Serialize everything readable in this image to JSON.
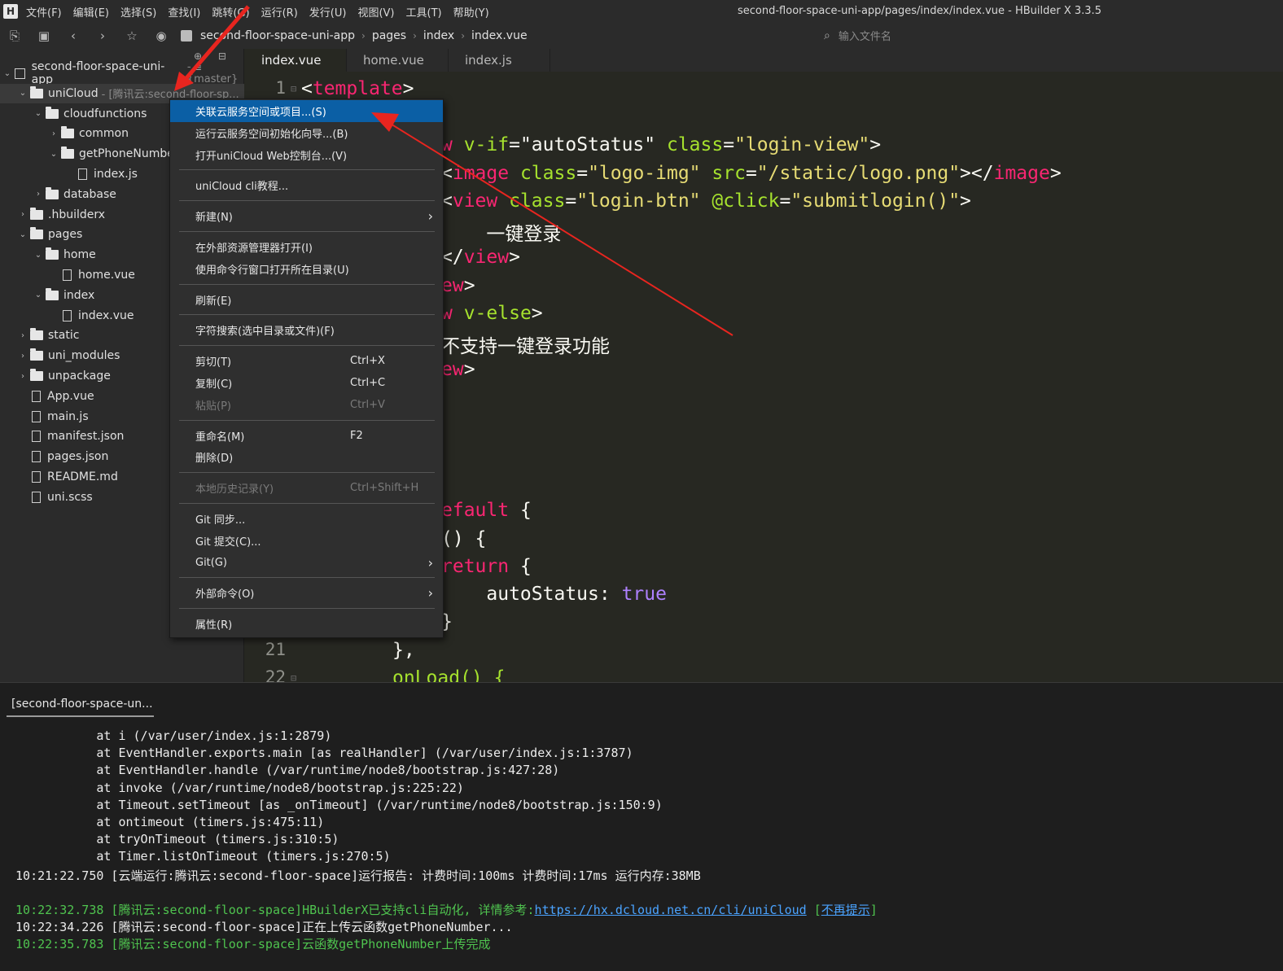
{
  "window": {
    "app_logo": "H",
    "title": "second-floor-space-uni-app/pages/index/index.vue - HBuilder X 3.3.5",
    "menu": [
      "文件(F)",
      "编辑(E)",
      "选择(S)",
      "查找(I)",
      "跳转(G)",
      "运行(R)",
      "发行(U)",
      "视图(V)",
      "工具(T)",
      "帮助(Y)"
    ]
  },
  "toolbar": {
    "icons": [
      "new-file-icon",
      "save-icon",
      "back-icon",
      "forward-icon",
      "star-icon",
      "run-icon"
    ],
    "breadcrumb": [
      "second-floor-space-uni-app",
      "pages",
      "index",
      "index.vue"
    ],
    "search_placeholder": "输入文件名"
  },
  "sidebar": {
    "tree": [
      {
        "label": "second-floor-space-uni-app",
        "suffix": "- {master}",
        "depth": 0,
        "type": "project",
        "expanded": true
      },
      {
        "label": "uniCloud",
        "suffix": "- [腾讯云:second-floor-sp...",
        "depth": 1,
        "type": "folder",
        "expanded": true,
        "selected": true
      },
      {
        "label": "cloudfunctions",
        "depth": 2,
        "type": "folder",
        "expanded": true
      },
      {
        "label": "common",
        "depth": 3,
        "type": "folder",
        "expanded": false
      },
      {
        "label": "getPhoneNumber",
        "depth": 3,
        "type": "folder",
        "expanded": true
      },
      {
        "label": "index.js",
        "depth": 4,
        "type": "file"
      },
      {
        "label": "database",
        "depth": 2,
        "type": "folder",
        "expanded": false
      },
      {
        "label": ".hbuilderx",
        "depth": 1,
        "type": "folder",
        "expanded": false
      },
      {
        "label": "pages",
        "depth": 1,
        "type": "folder",
        "expanded": true
      },
      {
        "label": "home",
        "depth": 2,
        "type": "folder",
        "expanded": true
      },
      {
        "label": "home.vue",
        "depth": 3,
        "type": "file"
      },
      {
        "label": "index",
        "depth": 2,
        "type": "folder",
        "expanded": true
      },
      {
        "label": "index.vue",
        "depth": 3,
        "type": "file"
      },
      {
        "label": "static",
        "depth": 1,
        "type": "folder",
        "expanded": false
      },
      {
        "label": "uni_modules",
        "depth": 1,
        "type": "folder",
        "expanded": false
      },
      {
        "label": "unpackage",
        "depth": 1,
        "type": "folder",
        "expanded": false
      },
      {
        "label": "App.vue",
        "depth": 1,
        "type": "file"
      },
      {
        "label": "main.js",
        "depth": 1,
        "type": "file"
      },
      {
        "label": "manifest.json",
        "depth": 1,
        "type": "file"
      },
      {
        "label": "pages.json",
        "depth": 1,
        "type": "file"
      },
      {
        "label": "README.md",
        "depth": 1,
        "type": "file"
      },
      {
        "label": "uni.scss",
        "depth": 1,
        "type": "file"
      }
    ]
  },
  "tabs": [
    "index.vue",
    "home.vue",
    "index.js"
  ],
  "editor": {
    "line_numbers": [
      "1",
      "21",
      "22"
    ],
    "lines": [
      [
        {
          "t": "<",
          "c": "plain"
        },
        {
          "t": "template",
          "c": "tag"
        },
        {
          "t": ">",
          "c": "plain"
        }
      ],
      [
        {
          "t": "w ",
          "c": "tag"
        },
        {
          "t": "v-if",
          "c": "attr"
        },
        {
          "t": "=",
          "c": "plain"
        },
        {
          "t": "\"autoStatus\"",
          "c": "plain"
        },
        {
          "t": " class",
          "c": "attr"
        },
        {
          "t": "=",
          "c": "plain"
        },
        {
          "t": "\"login-view\"",
          "c": "str"
        },
        {
          "t": ">",
          "c": "plain"
        }
      ],
      [
        {
          "t": "<",
          "c": "plain"
        },
        {
          "t": "image",
          "c": "tag"
        },
        {
          "t": " class",
          "c": "attr"
        },
        {
          "t": "=",
          "c": "plain"
        },
        {
          "t": "\"logo-img\"",
          "c": "str"
        },
        {
          "t": " src",
          "c": "attr"
        },
        {
          "t": "=",
          "c": "plain"
        },
        {
          "t": "\"/static/logo.png\"",
          "c": "str"
        },
        {
          "t": "></",
          "c": "plain"
        },
        {
          "t": "image",
          "c": "tag"
        },
        {
          "t": ">",
          "c": "plain"
        }
      ],
      [
        {
          "t": "<",
          "c": "plain"
        },
        {
          "t": "view",
          "c": "tag"
        },
        {
          "t": " class",
          "c": "attr"
        },
        {
          "t": "=",
          "c": "plain"
        },
        {
          "t": "\"login-btn\"",
          "c": "str"
        },
        {
          "t": " @click",
          "c": "attr"
        },
        {
          "t": "=",
          "c": "plain"
        },
        {
          "t": "\"submitlogin()\"",
          "c": "str"
        },
        {
          "t": ">",
          "c": "plain"
        }
      ],
      [
        {
          "t": "    一键登录",
          "c": "plain"
        }
      ],
      [
        {
          "t": "</",
          "c": "plain"
        },
        {
          "t": "view",
          "c": "tag"
        },
        {
          "t": ">",
          "c": "plain"
        }
      ],
      [
        {
          "t": "ew",
          "c": "tag"
        },
        {
          "t": ">",
          "c": "plain"
        }
      ],
      [
        {
          "t": "w ",
          "c": "tag"
        },
        {
          "t": "v-else",
          "c": "attr"
        },
        {
          "t": ">",
          "c": "plain"
        }
      ],
      [
        {
          "t": "不支持一键登录功能",
          "c": "plain"
        }
      ],
      [
        {
          "t": "ew",
          "c": "tag"
        },
        {
          "t": ">",
          "c": "plain"
        }
      ],
      [
        {
          "t": "efault",
          "c": "kw"
        },
        {
          "t": " {",
          "c": "plain"
        }
      ],
      [
        {
          "t": "() {",
          "c": "plain"
        }
      ],
      [
        {
          "t": "return",
          "c": "kw"
        },
        {
          "t": " {",
          "c": "plain"
        }
      ],
      [
        {
          "t": "    autoStatus: ",
          "c": "plain"
        },
        {
          "t": "true",
          "c": "bool"
        }
      ],
      [
        {
          "t": "}",
          "c": "plain"
        }
      ],
      [
        {
          "t": "},",
          "c": "plain"
        }
      ],
      [
        {
          "t": "onLoad() {",
          "c": "attr"
        }
      ]
    ]
  },
  "context_menu": {
    "items": [
      {
        "label": "关联云服务空间或项目...(S)",
        "highlighted": true
      },
      {
        "label": "运行云服务空间初始化向导...(B)"
      },
      {
        "label": "打开uniCloud Web控制台...(V)"
      },
      {
        "sep": true
      },
      {
        "label": "uniCloud cli教程..."
      },
      {
        "sep": true
      },
      {
        "label": "新建(N)",
        "submenu": true
      },
      {
        "sep": true
      },
      {
        "label": "在外部资源管理器打开(I)"
      },
      {
        "label": "使用命令行窗口打开所在目录(U)"
      },
      {
        "sep": true
      },
      {
        "label": "刷新(E)"
      },
      {
        "sep": true
      },
      {
        "label": "字符搜索(选中目录或文件)(F)"
      },
      {
        "sep": true
      },
      {
        "label": "剪切(T)",
        "shortcut": "Ctrl+X"
      },
      {
        "label": "复制(C)",
        "shortcut": "Ctrl+C"
      },
      {
        "label": "粘贴(P)",
        "shortcut": "Ctrl+V",
        "disabled": true
      },
      {
        "sep": true
      },
      {
        "label": "重命名(M)",
        "shortcut": "F2"
      },
      {
        "label": "删除(D)"
      },
      {
        "sep": true
      },
      {
        "label": "本地历史记录(Y)",
        "shortcut": "Ctrl+Shift+H",
        "disabled": true
      },
      {
        "sep": true
      },
      {
        "label": "Git 同步..."
      },
      {
        "label": "Git 提交(C)..."
      },
      {
        "label": "Git(G)",
        "submenu": true
      },
      {
        "sep": true
      },
      {
        "label": "外部命令(O)",
        "submenu": true
      },
      {
        "sep": true
      },
      {
        "label": "属性(R)"
      }
    ]
  },
  "console": {
    "tab": "[second-floor-space-un...",
    "lines": [
      {
        "parts": [
          {
            "t": "            at i (/var/user/index.js:1:2879)"
          }
        ]
      },
      {
        "parts": [
          {
            "t": "            at EventHandler.exports.main [as realHandler] (/var/user/index.js:1:3787)"
          }
        ]
      },
      {
        "parts": [
          {
            "t": "            at EventHandler.handle (/var/runtime/node8/bootstrap.js:427:28)"
          }
        ]
      },
      {
        "parts": [
          {
            "t": "            at invoke (/var/runtime/node8/bootstrap.js:225:22)"
          }
        ]
      },
      {
        "parts": [
          {
            "t": "            at Timeout.setTimeout [as _onTimeout] (/var/runtime/node8/bootstrap.js:150:9)"
          }
        ]
      },
      {
        "parts": [
          {
            "t": "            at ontimeout (timers.js:475:11)"
          }
        ]
      },
      {
        "parts": [
          {
            "t": "            at tryOnTimeout (timers.js:310:5)"
          }
        ]
      },
      {
        "parts": [
          {
            "t": "            at Timer.listOnTimeout (timers.js:270:5)"
          }
        ]
      },
      {
        "parts": [
          {
            "t": " 10:21:22.750 [云端运行:腾讯云:second-floor-space]运行报告: 计费时间:100ms 计费时间:17ms 运行内存:38MB"
          }
        ]
      },
      {
        "parts": [
          {
            "t": ""
          }
        ]
      },
      {
        "parts": [
          {
            "t": " 10:22:32.738 [腾讯云:second-floor-space]HBuilderX已支持cli自动化, 详情参考:",
            "c": "green"
          },
          {
            "t": "https://hx.dcloud.net.cn/cli/uniCloud",
            "c": "link"
          },
          {
            "t": " [",
            "c": "green"
          },
          {
            "t": "不再提示",
            "c": "link"
          },
          {
            "t": "]",
            "c": "green"
          }
        ]
      },
      {
        "parts": [
          {
            "t": " 10:22:34.226 [腾讯云:second-floor-space]正在上传云函数getPhoneNumber..."
          }
        ]
      },
      {
        "parts": [
          {
            "t": " 10:22:35.783 [腾讯云:second-floor-space]云函数getPhoneNumber上传完成",
            "c": "green"
          }
        ]
      }
    ]
  },
  "colors": {
    "annotation_arrow": "#e8251f",
    "menu_highlight": "#0b5fa5",
    "console_success": "#4fc34f",
    "link": "#4aa3ff"
  }
}
